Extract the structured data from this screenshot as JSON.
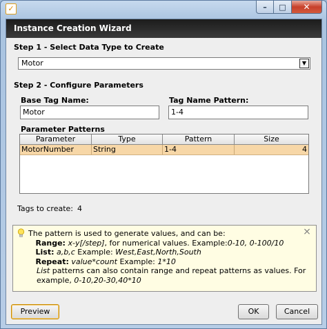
{
  "window": {
    "app_icon_glyph": "✓",
    "minimize_glyph": "–",
    "maximize_glyph": "□",
    "close_glyph": "✕"
  },
  "dialog": {
    "title": "Instance Creation Wizard"
  },
  "step1": {
    "label": "Step 1 - Select Data Type to Create",
    "data_type_value": "Motor",
    "dropdown_arrow": "▼"
  },
  "step2": {
    "label": "Step 2 - Configure Parameters",
    "base_tag_label": "Base Tag Name:",
    "base_tag_value": "Motor",
    "pattern_label": "Tag Name Pattern:",
    "pattern_value": "1-4",
    "param_patterns_label": "Parameter Patterns",
    "table": {
      "columns": [
        "Parameter",
        "Type",
        "Pattern",
        "Size"
      ],
      "rows": [
        [
          "MotorNumber",
          "String",
          "1-4",
          "4"
        ]
      ]
    }
  },
  "tags": {
    "label": "Tags to create:",
    "count": "4"
  },
  "info": {
    "icon": "lightbulb-icon",
    "line1": "The pattern is used to generate values, and can be:",
    "range_label": "Range:",
    "range_syntax": "x-y[/step]",
    "range_text": ", for numerical values. Example:",
    "range_example": "0-10, 0-100/10",
    "list_label": "List:",
    "list_syntax": "a,b,c",
    "list_text": " Example: ",
    "list_example": "West,East,North,South",
    "repeat_label": "Repeat:",
    "repeat_syntax": "value*count",
    "repeat_text": " Example: ",
    "repeat_example": "1*10",
    "note_list": "List",
    "note_text": " patterns can also contain range and repeat patterns as values. For example, ",
    "note_example": "0-10,20-30,40*10",
    "close_glyph": "⨯"
  },
  "buttons": {
    "preview": "Preview",
    "ok": "OK",
    "cancel": "Cancel"
  },
  "colors": {
    "header_bg": "#2a2a2a",
    "selected_row": "#f7d7a7",
    "info_bg": "#fffde3",
    "preview_focus": "#c88a00"
  }
}
